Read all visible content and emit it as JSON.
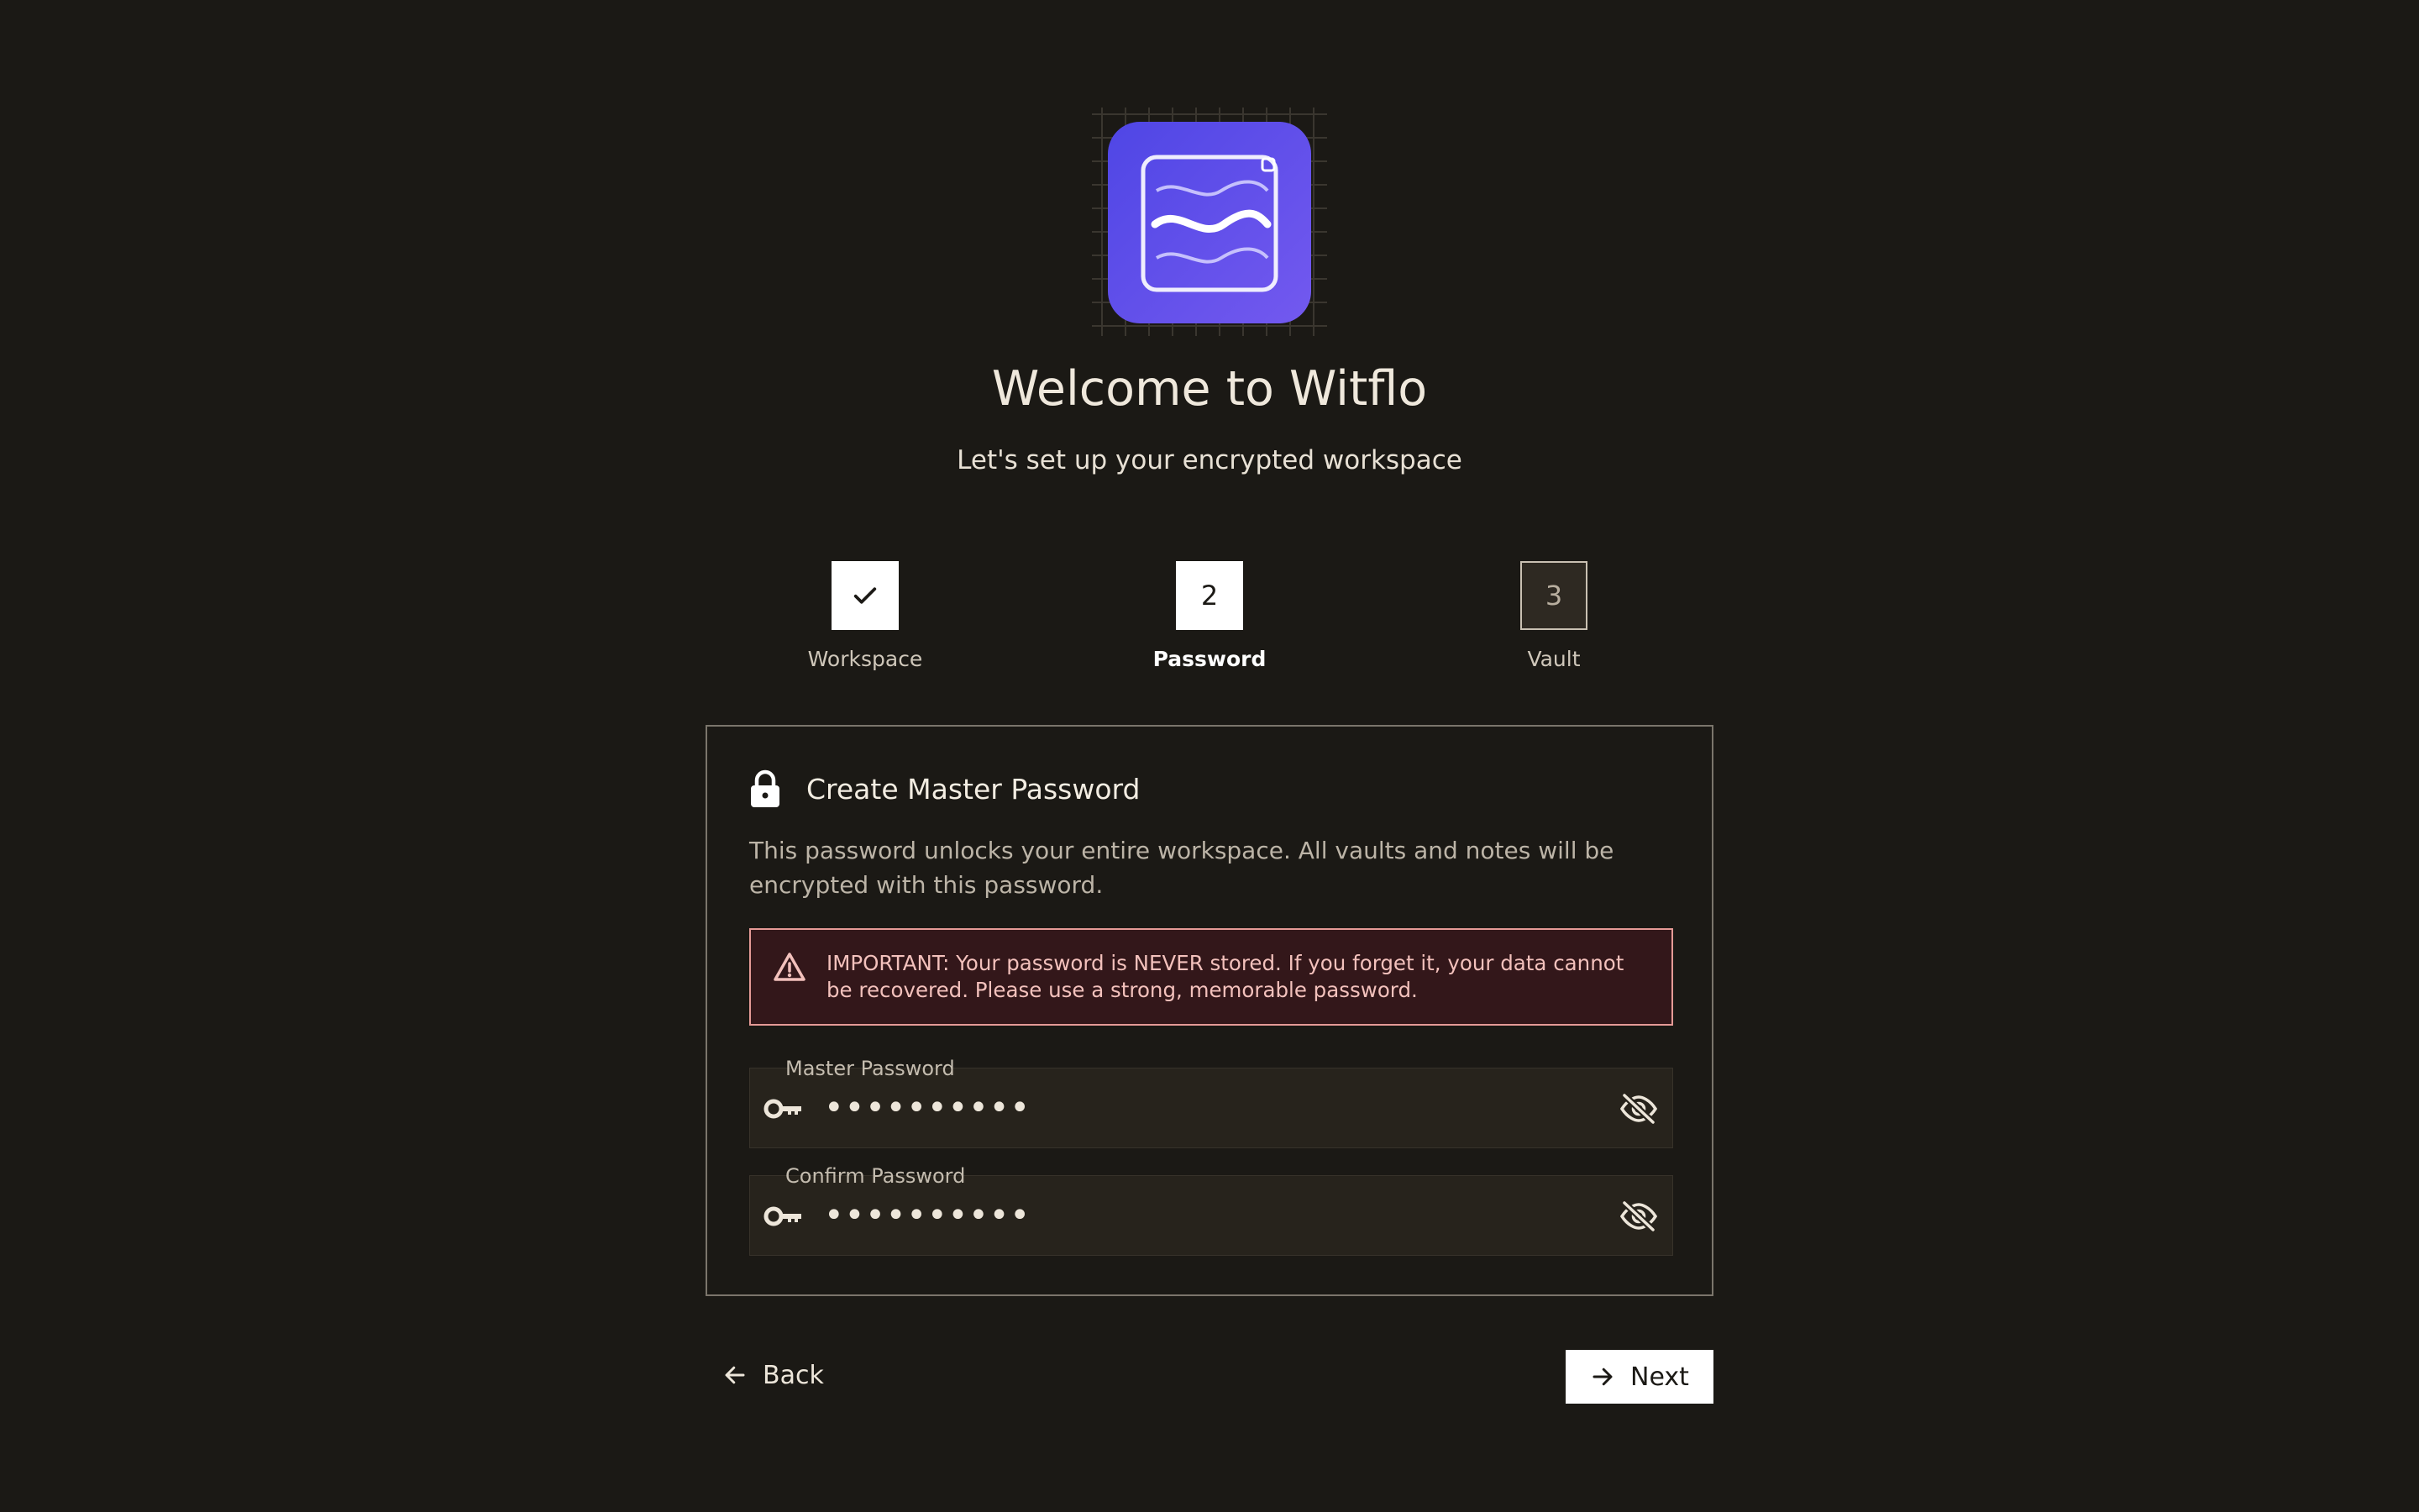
{
  "header": {
    "title": "Welcome to Witflo",
    "subtitle": "Let's set up your encrypted workspace"
  },
  "logo": {
    "icon": "witflo-logo-icon"
  },
  "stepper": {
    "steps": [
      {
        "number": "",
        "label": "Workspace",
        "state": "completed"
      },
      {
        "number": "2",
        "label": "Password",
        "state": "active"
      },
      {
        "number": "3",
        "label": "Vault",
        "state": "pending"
      }
    ]
  },
  "card": {
    "title": "Create Master Password",
    "description": "This password unlocks your entire workspace. All vaults and notes will be encrypted with this password.",
    "warning": "IMPORTANT: Your password is NEVER stored. If you forget it, your data cannot be recovered. Please use a strong, memorable password.",
    "fields": {
      "master": {
        "label": "Master Password",
        "value": "••••••••••"
      },
      "confirm": {
        "label": "Confirm Password",
        "value": "••••••••••"
      }
    }
  },
  "footer": {
    "back_label": "Back",
    "next_label": "Next"
  },
  "colors": {
    "background": "#1b1915",
    "accent": "#4f46e5",
    "warning_border": "#e59a96",
    "warning_bg": "#33171a"
  }
}
